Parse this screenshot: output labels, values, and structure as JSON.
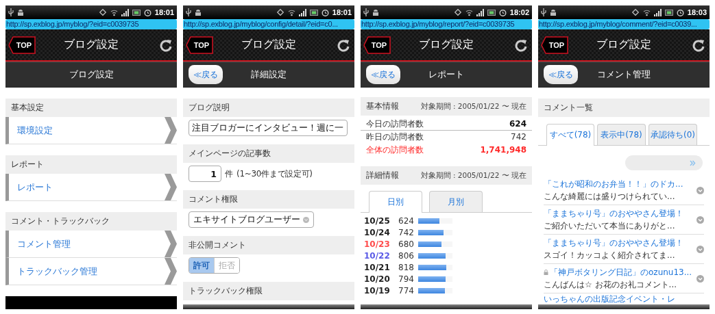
{
  "screens": [
    {
      "kind": "menu",
      "time": "18:01",
      "url": "http://sp.exblog.jp/myblog/?eid=c0039735",
      "top_button": "TOP",
      "title": "ブログ設定",
      "subtitle": "ブログ設定",
      "sections": [
        {
          "heading": "基本設定",
          "items": [
            "環境設定"
          ]
        },
        {
          "heading": "レポート",
          "items": [
            "レポート"
          ]
        },
        {
          "heading": "コメント・トラックバック",
          "items": [
            "コメント管理",
            "トラックバック管理"
          ]
        }
      ]
    },
    {
      "kind": "form",
      "time": "18:01",
      "url": "http://sp.exblog.jp/myblog/config/detail/?eid=c0...",
      "top_button": "TOP",
      "title": "ブログ設定",
      "back_button": "≪戻る",
      "subtitle": "詳細設定",
      "fields": [
        {
          "kind": "text",
          "label": "ブログ説明",
          "value": "注目ブロガーにインタビュー！週に一"
        },
        {
          "kind": "number",
          "label": "メインページの記事数",
          "value": "1",
          "unit": "件",
          "hint": "(1~30件まで設定可)"
        },
        {
          "kind": "select",
          "label": "コメント権限",
          "value": "エキサイトブログユーザー"
        },
        {
          "kind": "segmented",
          "label": "非公開コメント",
          "options": [
            {
              "label": "許可",
              "selected": true
            },
            {
              "label": "拒否",
              "selected": false
            }
          ]
        },
        {
          "kind": "heading",
          "label": "トラックバック権限"
        }
      ]
    },
    {
      "kind": "report",
      "time": "18:02",
      "url": "http://sp.exblog.jp/myblog/report/?eid=c0039735",
      "top_button": "TOP",
      "title": "ブログ設定",
      "back_button": "≪戻る",
      "subtitle": "レポート",
      "basic": {
        "heading": "基本情報",
        "period": "対象期間 : 2005/01/22 〜 現在",
        "stats": [
          {
            "kind": "bold",
            "label": "今日の訪問者数",
            "value": "624"
          },
          {
            "kind": "plain",
            "label": "昨日の訪問者数",
            "value": "742"
          },
          {
            "kind": "total",
            "label": "全体の訪問者数",
            "value": "1,741,948"
          }
        ]
      },
      "detail": {
        "heading": "詳細情報",
        "period": "対象期間 : 2005/01/22 〜 現在",
        "tabs": [
          {
            "label": "日別",
            "selected": true
          },
          {
            "label": "月別",
            "selected": false
          }
        ],
        "days": [
          {
            "date": "10/25",
            "count": "624",
            "level": 0.624,
            "color": "#222222"
          },
          {
            "date": "10/24",
            "count": "742",
            "level": 0.742,
            "color": "#222222"
          },
          {
            "date": "10/23",
            "count": "680",
            "level": 0.68,
            "color": "#ff4b4b"
          },
          {
            "date": "10/22",
            "count": "806",
            "level": 0.806,
            "color": "#5a5ae6"
          },
          {
            "date": "10/21",
            "count": "818",
            "level": 0.818,
            "color": "#222222"
          },
          {
            "date": "10/20",
            "count": "794",
            "level": 0.794,
            "color": "#222222"
          },
          {
            "date": "10/19",
            "count": "774",
            "level": 0.774,
            "color": "#222222"
          }
        ]
      }
    },
    {
      "kind": "comments",
      "time": "18:03",
      "url": "http://sp.exblog.jp/myblog/comment/?eid=c0039...",
      "top_button": "TOP",
      "title": "ブログ設定",
      "back_button": "≪戻る",
      "subtitle": "コメント管理",
      "heading": "コメント一覧",
      "tabs": [
        {
          "label": "すべて(78)",
          "selected": true
        },
        {
          "label": "表示中(78)",
          "selected": false
        },
        {
          "label": "承認待ち(0)",
          "selected": false
        }
      ],
      "comments": [
        {
          "title": "「これが昭和のお弁当！！」のドカ...",
          "snippet": "こんな綺麗には盛りつけられてい...",
          "locked": false
        },
        {
          "title": "「ままちゃり号」のおややさん登場！",
          "snippet": "ご紹介いただいて本当にありがと...",
          "locked": false
        },
        {
          "title": "「ままちゃり号」のおややさん登場！",
          "snippet": "スゴイ！カッコよく紹介されてま...",
          "locked": false
        },
        {
          "title": "「神戸ボタリング日記」のozunu13...",
          "snippet": "こんばんは☆ お花のお礼コメント...",
          "locked": true
        },
        {
          "title": "いっちゃんの出版記念イベント・レ",
          "locked": false
        }
      ]
    }
  ]
}
